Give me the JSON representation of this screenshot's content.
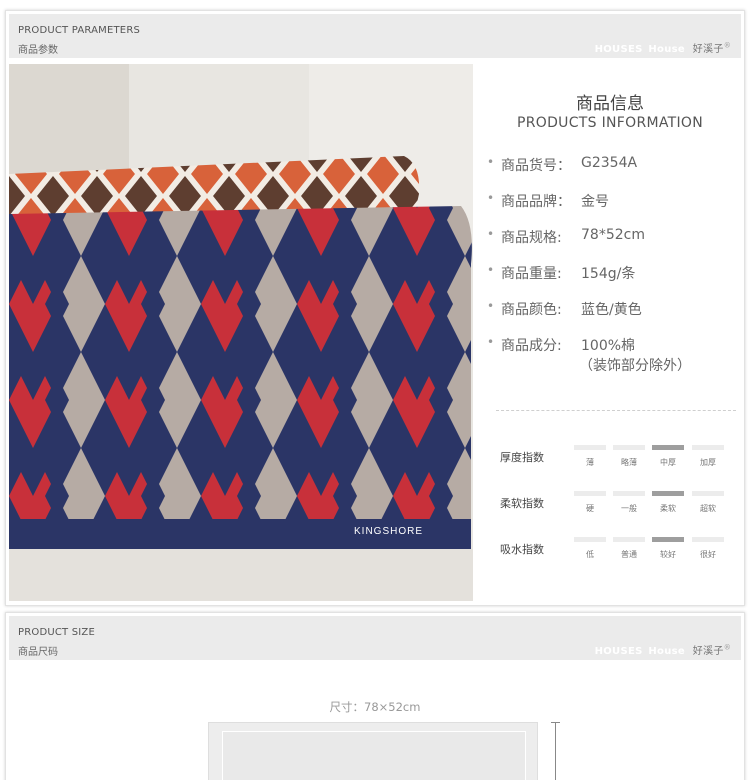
{
  "section1": {
    "header_en": "PRODUCT PARAMETERS",
    "header_cn": "商品参数",
    "brand_en_1": "HOUSES",
    "brand_en_2": "House",
    "brand_cn": "好溪子",
    "brand_reg": "®"
  },
  "photo": {
    "pillow_logo": "KINGSHORE"
  },
  "info": {
    "title_cn": "商品信息",
    "title_en": "PRODUCTS INFORMATION",
    "bullet": "•",
    "specs": [
      {
        "label": "商品货号：",
        "value": "G2354A"
      },
      {
        "label": "商品品牌：",
        "value": "金号"
      },
      {
        "label": "商品规格:",
        "value": "78*52cm"
      },
      {
        "label": "商品重量:",
        "value": "154g/条"
      },
      {
        "label": "商品颜色:",
        "value": "蓝色/黄色"
      },
      {
        "label": "商品成分:",
        "value": "100%棉",
        "value2": "（装饰部分除外）"
      }
    ]
  },
  "indices": [
    {
      "label": "厚度指数",
      "options": [
        "薄",
        "略薄",
        "中厚",
        "加厚"
      ],
      "selected": 2
    },
    {
      "label": "柔软指数",
      "options": [
        "硬",
        "一般",
        "柔软",
        "超软"
      ],
      "selected": 2
    },
    {
      "label": "吸水指数",
      "options": [
        "低",
        "普通",
        "较好",
        "很好"
      ],
      "selected": 2
    }
  ],
  "section2": {
    "header_en": "PRODUCT SIZE",
    "header_cn": "商品尺码",
    "brand_en_1": "HOUSES",
    "brand_en_2": "House",
    "brand_cn": "好溪子",
    "brand_reg": "®",
    "size_caption": "尺寸：78×52cm"
  },
  "colors": {
    "navy": "#2b3566",
    "red": "#c8303a",
    "taupe": "#b6aba4",
    "orange": "#d8623a",
    "brown": "#5e3e30",
    "cream": "#f2ece4"
  }
}
